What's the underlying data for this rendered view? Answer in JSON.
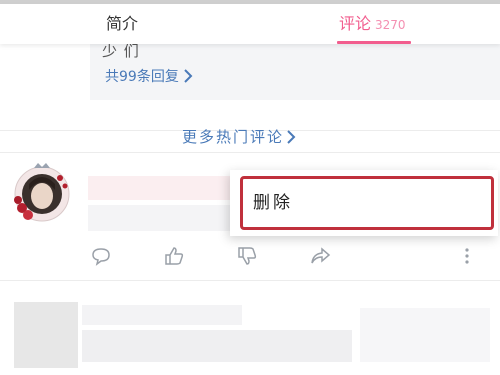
{
  "tabs": {
    "intro_label": "简介",
    "comments_label": "评论",
    "comments_count": "3270",
    "active_color": "#f25d8e"
  },
  "reply_box": {
    "partial_text": "少 们",
    "view_replies_label": "共99条回复"
  },
  "more_hot_comments_label": "更多热门评论",
  "context_menu": {
    "delete_label": "删除",
    "highlight_color": "#c0303c"
  },
  "actions": [
    "comment-icon",
    "like-icon",
    "dislike-icon",
    "share-icon",
    "more-icon"
  ],
  "link_color": "#4a7ab8"
}
